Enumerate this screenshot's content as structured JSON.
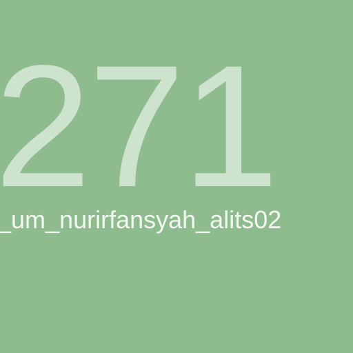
{
  "screen": {
    "background_color": "#8fbc8f",
    "count": "271",
    "count_color": "#cde3cd",
    "username": "_um_nurirfansyah_alits02",
    "username_color": "#f2f7f2"
  }
}
